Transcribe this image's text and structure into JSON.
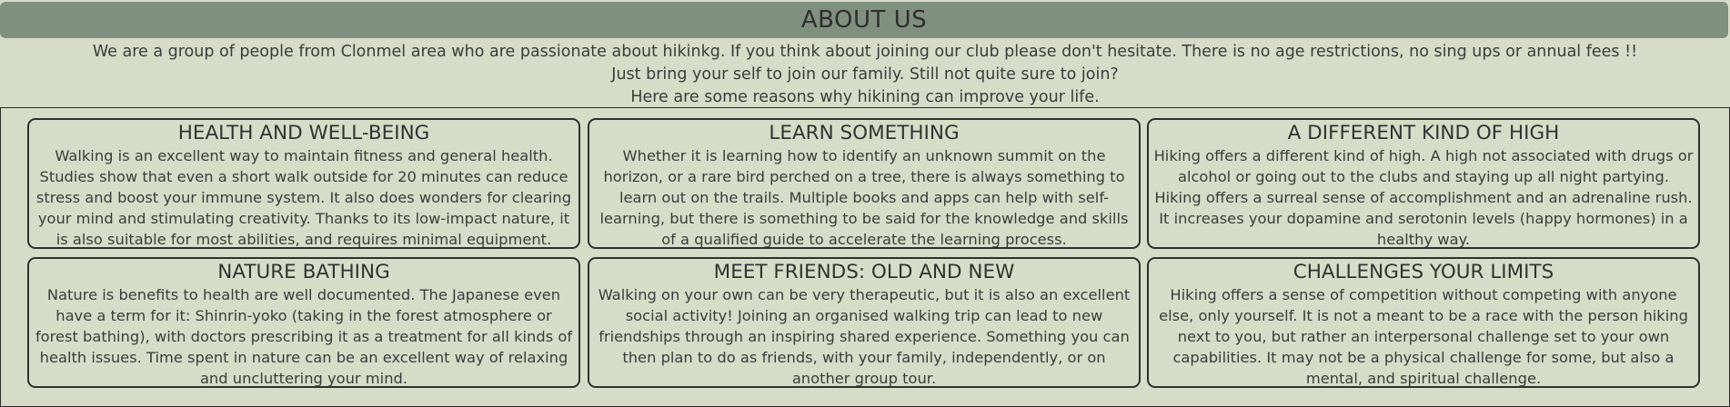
{
  "header": {
    "title": "ABOUT US"
  },
  "intro": {
    "line1": "We are a group of people from Clonmel area who are passionate about hikinkg. If you think about joining our club please don't hesitate. There is no age restrictions, no sing ups or annual fees !!",
    "line2": "Just bring your self to join our family. Still not quite sure to join?",
    "line3": "Here are some reasons why hikining can improve your life."
  },
  "cards": [
    {
      "title": "HEALTH AND WELL-BEING",
      "text": "Walking is an excellent way to maintain fitness and general health. Studies show that even a short walk outside for 20 minutes can reduce stress and boost your immune system. It also does wonders for clearing your mind and stimulating creativity. Thanks to its low-impact nature, it is also suitable for most abilities, and requires minimal equipment."
    },
    {
      "title": "LEARN SOMETHING",
      "text": "Whether it is learning how to identify an unknown summit on the horizon, or a rare bird perched on a tree, there is always something to learn out on the trails. Multiple books and apps can help with self-learning, but there is something to be said for the knowledge and skills of a qualified guide to accelerate the learning process."
    },
    {
      "title": "A DIFFERENT KIND OF HIGH",
      "text": "Hiking offers a different kind of high. A high not associated with drugs or alcohol or going out to the clubs and staying up all night partying. Hiking offers a surreal sense of accomplishment and an adrenaline rush. It increases your dopamine and serotonin levels (happy hormones) in a healthy way."
    },
    {
      "title": "NATURE BATHING",
      "text": "Nature is benefits to health are well documented. The Japanese even have a term for it: Shinrin-yoko (taking in the forest atmosphere or forest bathing), with doctors prescribing it as a treatment for all kinds of health issues. Time spent in nature can be an excellent way of relaxing and uncluttering your mind."
    },
    {
      "title": "MEET FRIENDS: OLD AND NEW",
      "text": "Walking on your own can be very therapeutic, but it is also an excellent social activity! Joining an organised walking trip can lead to new friendships through an inspiring shared experience. Something you can then plan to do as friends, with your family, independently, or on another group tour."
    },
    {
      "title": "CHALLENGES YOUR LIMITS",
      "text": "Hiking offers a sense of competition without competing with anyone else, only yourself. It is not a meant to be a race with the person hiking next to you, but rather an interpersonal challenge set to your own capabilities. It may not be a physical challenge for some, but also a mental, and spiritual challenge."
    }
  ]
}
